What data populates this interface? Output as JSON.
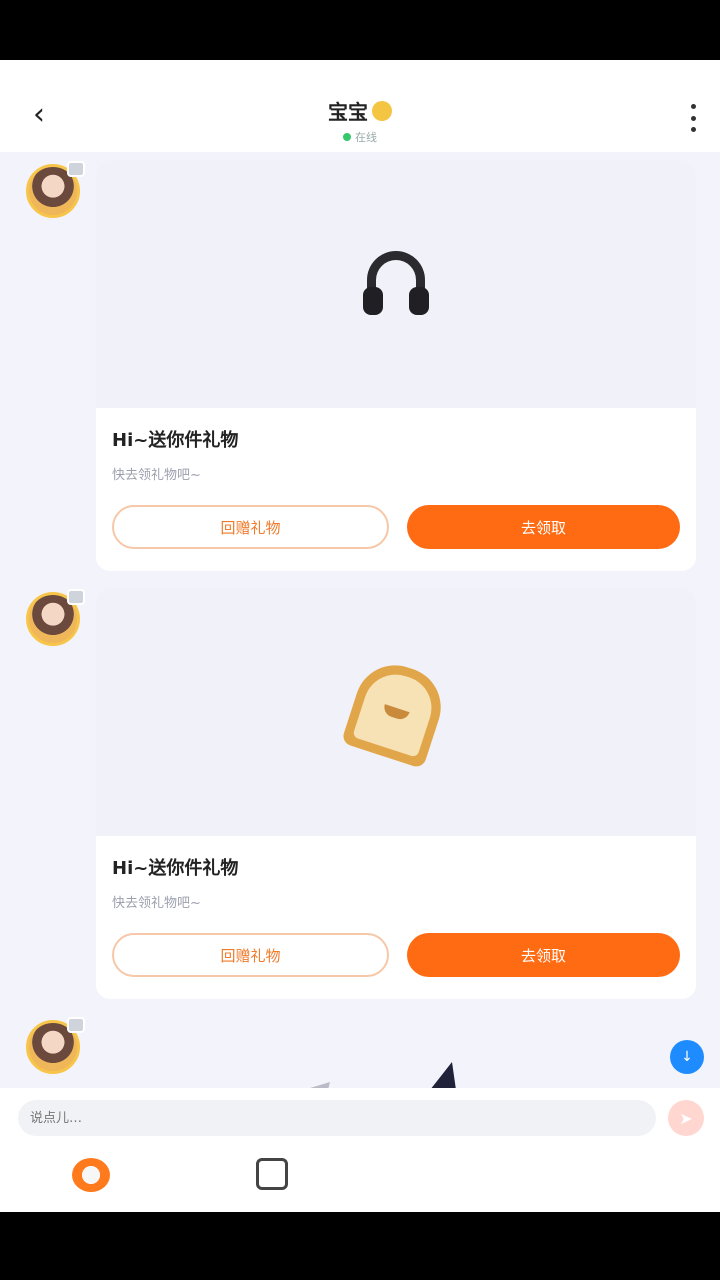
{
  "header": {
    "title": "宝宝",
    "status": "在线",
    "back_icon": "chevron-left-icon",
    "more_icon": "more-vertical-icon"
  },
  "messages": [
    {
      "title": "Hi~送你件礼物",
      "subtitle": "快去领礼物吧~",
      "gift": "headphones",
      "return_label": "回赠礼物",
      "view_label": "去领取"
    },
    {
      "title": "Hi~送你件礼物",
      "subtitle": "快去领礼物吧~",
      "gift": "toast",
      "return_label": "回赠礼物",
      "view_label": "去领取"
    }
  ],
  "input": {
    "placeholder": "说点儿…"
  },
  "colors": {
    "accent": "#ff6b12",
    "background": "#f3f4fb"
  }
}
